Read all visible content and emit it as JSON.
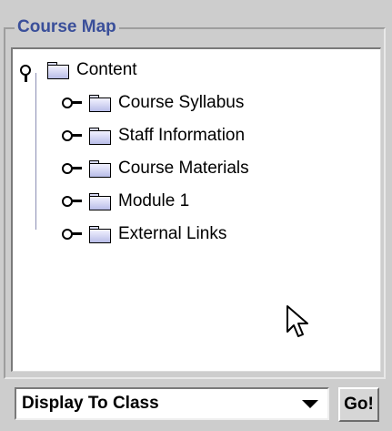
{
  "group": {
    "title": "Course Map"
  },
  "tree": {
    "root": {
      "label": "Content",
      "icon": "folder-icon",
      "expanded": true
    },
    "children": [
      {
        "label": "Course Syllabus",
        "icon": "folder-icon",
        "expanded": false
      },
      {
        "label": "Staff Information",
        "icon": "folder-icon",
        "expanded": false
      },
      {
        "label": "Course Materials",
        "icon": "folder-icon",
        "expanded": false
      },
      {
        "label": "Module 1",
        "icon": "folder-icon",
        "expanded": false
      },
      {
        "label": "External Links",
        "icon": "folder-icon",
        "expanded": false
      }
    ]
  },
  "controls": {
    "display_select": {
      "value": "Display To Class"
    },
    "go_label": "Go!"
  },
  "colors": {
    "title": "#3a4f9a",
    "folder": "#c3c6ee",
    "tree_line": "#8c8fb4"
  }
}
